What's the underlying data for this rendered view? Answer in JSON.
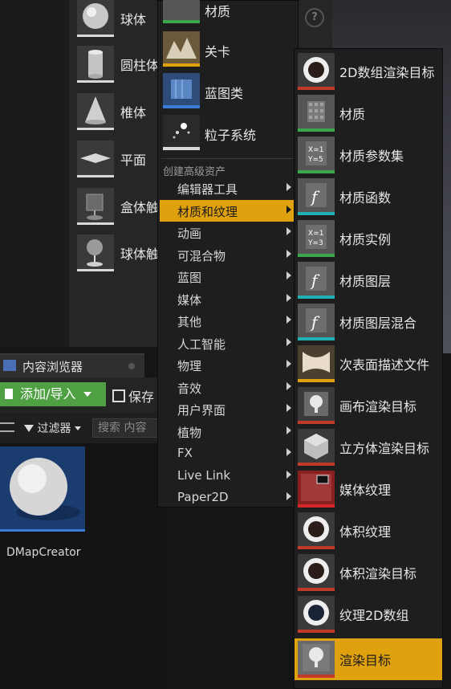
{
  "place_panel": {
    "shapes": [
      {
        "label": "球体",
        "icon": "sphere-icon"
      },
      {
        "label": "圆柱体",
        "icon": "cylinder-icon"
      },
      {
        "label": "椎体",
        "icon": "cone-icon"
      },
      {
        "label": "平面",
        "icon": "plane-icon"
      },
      {
        "label": "盒体触",
        "icon": "box-trigger-icon"
      },
      {
        "label": "球体触",
        "icon": "sphere-trigger-icon"
      }
    ],
    "help_icon": "?"
  },
  "content_browser": {
    "tab_label": "内容浏览器",
    "add_import_label": "添加/导入",
    "save_label": "保存",
    "filter_label": "过滤器",
    "search_placeholder": "搜索 内容",
    "asset_name": "DMapCreator"
  },
  "main_menu": {
    "top_items": [
      {
        "label": "材质",
        "icon": "material-icon",
        "color": "#3aa84a"
      },
      {
        "label": "关卡",
        "icon": "level-icon",
        "color": "#e0a10e"
      },
      {
        "label": "蓝图类",
        "icon": "blueprint-icon",
        "color": "#3a7bd5"
      },
      {
        "label": "粒子系统",
        "icon": "particle-system-icon",
        "color": "#d9d9d9"
      }
    ],
    "section_header": "创建高级资产",
    "categories": [
      "编辑器工具",
      "材质和纹理",
      "动画",
      "可混合物",
      "蓝图",
      "媒体",
      "其他",
      "人工智能",
      "物理",
      "音效",
      "用户界面",
      "植物",
      "FX",
      "Live Link",
      "Paper2D"
    ],
    "active_category": "材质和纹理"
  },
  "sub_menu": {
    "items": [
      {
        "label": "2D数组渲染目标",
        "icon": "render-target-2d-array-icon",
        "color": "#c0392b"
      },
      {
        "label": "材质",
        "icon": "material-icon",
        "color": "#3aa84a"
      },
      {
        "label": "材质参数集",
        "icon": "material-parameter-collection-icon",
        "color": "#3aa84a"
      },
      {
        "label": "材质函数",
        "icon": "material-function-icon",
        "color": "#20b2b2"
      },
      {
        "label": "材质实例",
        "icon": "material-instance-icon",
        "color": "#3aa84a"
      },
      {
        "label": "材质图层",
        "icon": "material-layer-icon",
        "color": "#20b2b2"
      },
      {
        "label": "材质图层混合",
        "icon": "material-layer-blend-icon",
        "color": "#20b2b2"
      },
      {
        "label": "次表面描述文件",
        "icon": "subsurface-profile-icon",
        "color": "#e0a10e"
      },
      {
        "label": "画布渲染目标",
        "icon": "canvas-render-target-icon",
        "color": "#c0392b"
      },
      {
        "label": "立方体渲染目标",
        "icon": "cube-render-target-icon",
        "color": "#c0392b"
      },
      {
        "label": "媒体纹理",
        "icon": "media-texture-icon",
        "color": "#d62828"
      },
      {
        "label": "体积纹理",
        "icon": "volume-texture-icon",
        "color": "#c0392b"
      },
      {
        "label": "体积渲染目标",
        "icon": "volume-render-target-icon",
        "color": "#c0392b"
      },
      {
        "label": "纹理2D数组",
        "icon": "texture-2d-array-icon",
        "color": "#c0392b"
      },
      {
        "label": "渲染目标",
        "icon": "render-target-icon",
        "color": "#c0392b"
      }
    ],
    "active_item": "渲染目标"
  }
}
